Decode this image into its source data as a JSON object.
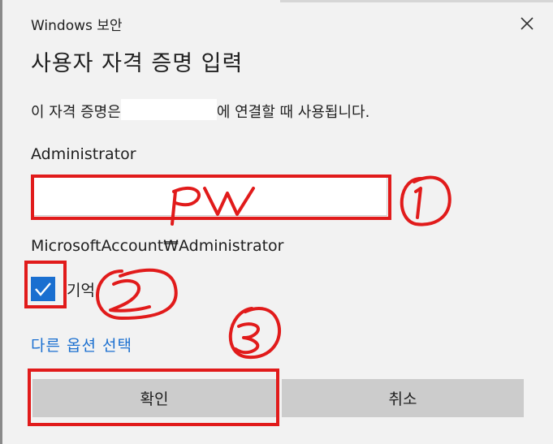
{
  "dialog": {
    "caption": "Windows 보안",
    "title": "사용자 자격 증명 입력",
    "description_before": "이 자격 증명은",
    "description_after": "에 연결할 때 사용됩니다.",
    "username": "Administrator",
    "password_value": "",
    "domain_account": "MicrosoftAccount₩Administrator",
    "remember_label": "기억",
    "remember_checked": true,
    "more_options": "다른 옵션 선택",
    "ok_label": "확인",
    "cancel_label": "취소"
  },
  "annotations": {
    "color": "#e11b1b",
    "password_note": "PW",
    "marker_1": "①",
    "marker_2": "②",
    "marker_3": "③"
  },
  "colors": {
    "accent": "#1a6fd0",
    "background": "#f2f2f2",
    "button": "#cccccc"
  }
}
